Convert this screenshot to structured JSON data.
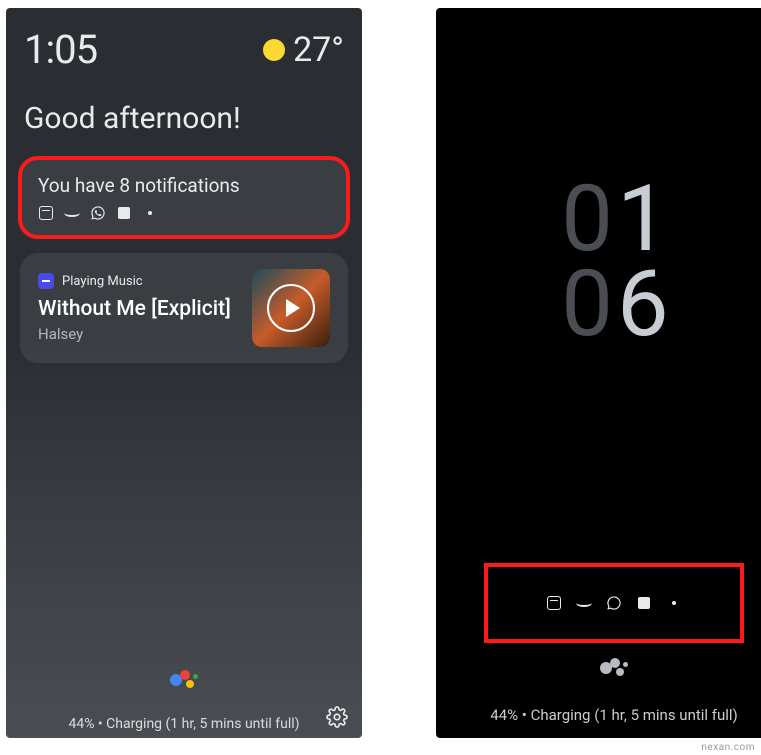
{
  "left": {
    "time": "1:05",
    "weather": {
      "temp": "27°"
    },
    "greeting": "Good afternoon!",
    "notifications": {
      "title": "You have 8 notifications"
    },
    "music": {
      "app_label": "Playing Music",
      "song": "Without Me [Explicit]",
      "artist": "Halsey"
    },
    "charging": "44% • Charging (1 hr, 5 mins until full)"
  },
  "right": {
    "clock": {
      "h1": "0",
      "h2": "1",
      "m1": "0",
      "m2": "6"
    },
    "charging": "44% • Charging (1 hr, 5 mins until full)"
  },
  "watermark": "nexan.com"
}
